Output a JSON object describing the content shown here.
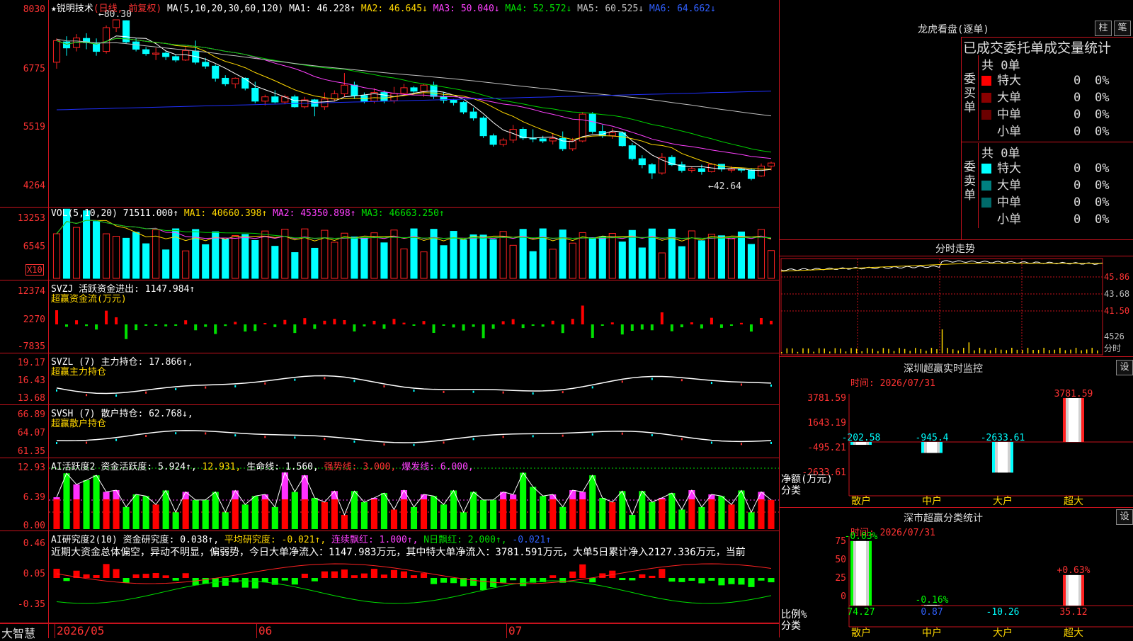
{
  "colors": {
    "up": "#ff2222",
    "down": "#00ffff",
    "grid": "#c8121d",
    "ma1": "#ffffff",
    "ma2": "#ffd700",
    "ma3": "#ff40ff",
    "ma4": "#00d000",
    "ma5": "#c0c0c0",
    "ma6": "#2030ff"
  },
  "kline": {
    "star": "★",
    "name": "锐明技术",
    "mode": "(日线, 前复权)",
    "ma_label": "MA(5,10,20,30,60,120)",
    "ma": [
      {
        "label": "MA1: 46.228↑",
        "color": "#ffffff"
      },
      {
        "label": "MA2: 46.645↓",
        "color": "#ffd700"
      },
      {
        "label": "MA3: 50.040↓",
        "color": "#ff40ff"
      },
      {
        "label": "MA4: 52.572↓",
        "color": "#00e000"
      },
      {
        "label": "MA5: 60.525↓",
        "color": "#c0c0c0"
      },
      {
        "label": "MA6: 64.662↓",
        "color": "#3060ff"
      }
    ],
    "y_labels": [
      "8030",
      "6775",
      "5519",
      "4264"
    ],
    "high_note": "←80.30",
    "low_note": "←42.64"
  },
  "vol": {
    "label": "VOL(5,10,20)",
    "value": "71511.000↑",
    "ma": [
      {
        "label": "MA1: 40660.398↑",
        "color": "#ffd700"
      },
      {
        "label": "MA2: 45350.898↑",
        "color": "#ff40ff"
      },
      {
        "label": "MA3: 46663.250↑",
        "color": "#00e000"
      }
    ],
    "y_labels": [
      "13253",
      "6545"
    ],
    "unit": "X10"
  },
  "svzj": {
    "label": "SVZJ  活跃资金进出: 1147.984↑",
    "sub": "超赢资金流(万元)",
    "y_labels": [
      "12374",
      "2270",
      "-7835"
    ]
  },
  "svzl": {
    "label": "SVZL (7) 主力持仓: 17.866↑,",
    "sub": "超赢主力持仓",
    "y_labels": [
      "19.17",
      "16.43",
      "13.68"
    ]
  },
  "svsh": {
    "label": "SVSH (7) 散户持仓: 62.768↓,",
    "sub": "超赢散户持仓",
    "y_labels": [
      "66.89",
      "64.07",
      "61.35"
    ]
  },
  "ai1": {
    "label": "AI活跃度2",
    "parts": [
      {
        "t": "资金活跃度: 5.924↑,",
        "c": "#ffffff"
      },
      {
        "t": "12.931,",
        "c": "#ffd700"
      },
      {
        "t": "生命线: 1.560,",
        "c": "#ffffff"
      },
      {
        "t": "强势线: 3.000,",
        "c": "#ff3333"
      },
      {
        "t": "爆发线: 6.000,",
        "c": "#ff40ff"
      }
    ],
    "y_labels": [
      "12.93",
      "6.39",
      "0.00"
    ]
  },
  "ai2": {
    "label": "AI研究度2(10)",
    "parts": [
      {
        "t": "资金研究度: 0.038↑,",
        "c": "#ffffff"
      },
      {
        "t": "平均研究度: -0.021↑,",
        "c": "#ffd700"
      },
      {
        "t": "连续飘红: 1.000↑,",
        "c": "#ff40ff"
      },
      {
        "t": "N日飘红: 2.000↑,",
        "c": "#00e000"
      },
      {
        "t": "-0.021↑",
        "c": "#3060ff"
      }
    ],
    "text": "近期大资金总体偏空，异动不明显，偏弱势，今日大单净流入：1147.983万元，其中特大单净流入：3781.591万元，大单5日累计净入2127.336万元，当前",
    "y_labels": [
      "0.46",
      "0.05",
      "-0.35"
    ]
  },
  "bottom": {
    "brand": "大智慧",
    "dates": [
      "2026/05",
      "06",
      "07"
    ]
  },
  "lhb": {
    "title": "龙虎看盘(逐单)",
    "btn1": "柱",
    "btn2": "笔",
    "header": "已成交委托单成交量统计",
    "buy": {
      "side": "委买单",
      "total": "共 0单",
      "rows": [
        {
          "name": "特大",
          "qty": "0",
          "pct": "0%",
          "color": "#ff0000"
        },
        {
          "name": "大单",
          "qty": "0",
          "pct": "0%",
          "color": "#8b0000"
        },
        {
          "name": "中单",
          "qty": "0",
          "pct": "0%",
          "color": "#6b0000"
        },
        {
          "name": "小单",
          "qty": "0",
          "pct": "0%",
          "color": ""
        }
      ]
    },
    "sell": {
      "side": "委卖单",
      "total": "共 0单",
      "rows": [
        {
          "name": "特大",
          "qty": "0",
          "pct": "0%",
          "color": "#00ffff"
        },
        {
          "name": "大单",
          "qty": "0",
          "pct": "0%",
          "color": "#008080"
        },
        {
          "name": "中单",
          "qty": "0",
          "pct": "0%",
          "color": "#006a6a"
        },
        {
          "name": "小单",
          "qty": "0",
          "pct": "0%",
          "color": ""
        }
      ]
    }
  },
  "intraday": {
    "title": "分时走势",
    "y_labels": [
      "45.86",
      "43.68",
      "41.50",
      "4526",
      "分时"
    ]
  },
  "sz_monitor": {
    "title": "深圳超赢实时监控",
    "btn": "设",
    "time": "时间: 2026/07/31",
    "y_labels": [
      "3781.59",
      "1643.19",
      "-495.21",
      "-2633.61"
    ],
    "axis_title": "净额(万元)",
    "axis_sub": "分类",
    "categories": [
      "散户",
      "中户",
      "大户",
      "超大"
    ],
    "values": [
      "-202.58",
      "-945.4",
      "-2633.61",
      "3781.59"
    ]
  },
  "sz_stat": {
    "title": "深市超赢分类统计",
    "btn": "设",
    "time": "时间: 2026/07/31",
    "y_labels": [
      "75",
      "50",
      "25",
      "0"
    ],
    "axis_title": "比例%",
    "axis_sub": "分类",
    "categories": [
      "散户",
      "中户",
      "大户",
      "超大"
    ],
    "top_labels": [
      "-0.03%",
      "-0.16%",
      "",
      "+0.63%"
    ],
    "values": [
      "74.27",
      "0.87",
      "-10.26",
      "35.12"
    ]
  },
  "chart_data": {
    "type": "candlestick",
    "x_labels": [
      "2026/05",
      "06",
      "07"
    ],
    "ylim": [
      42.64,
      80.3
    ],
    "candles": [
      [
        70.5,
        75.5,
        69,
        76
      ],
      [
        75.2,
        73.8,
        72,
        76.5
      ],
      [
        73.9,
        76.1,
        73,
        77
      ],
      [
        76,
        75,
        73.5,
        77.2
      ],
      [
        75,
        73,
        72,
        76
      ],
      [
        73,
        78.5,
        72.5,
        79
      ],
      [
        78.5,
        80.3,
        77.5,
        80.3
      ],
      [
        80.1,
        75.2,
        74.8,
        80.2
      ],
      [
        75.2,
        73.5,
        73,
        76
      ],
      [
        73.4,
        72.5,
        72,
        74
      ],
      [
        72.4,
        72.6,
        71,
        73.8
      ],
      [
        72.6,
        71.8,
        71,
        73
      ],
      [
        71.8,
        71,
        70.5,
        72.2
      ],
      [
        71,
        73.2,
        70.8,
        74
      ],
      [
        73.1,
        70.5,
        70,
        75.5
      ],
      [
        70.5,
        69.6,
        69,
        71.5
      ],
      [
        69.6,
        66.8,
        66,
        70
      ],
      [
        66.8,
        65.5,
        65,
        67.5
      ],
      [
        65.5,
        66.8,
        64.5,
        67
      ],
      [
        66.8,
        64.5,
        64,
        67
      ],
      [
        64.5,
        61.5,
        61,
        66
      ],
      [
        61.5,
        62.5,
        60.5,
        63
      ],
      [
        62.5,
        61.3,
        61,
        64
      ],
      [
        61.3,
        62.5,
        60.8,
        63
      ],
      [
        62.5,
        60.2,
        60,
        63
      ],
      [
        60.2,
        61.8,
        59.8,
        62.5
      ],
      [
        61.8,
        60.3,
        58,
        62
      ],
      [
        60.2,
        62,
        59.5,
        63.5
      ],
      [
        62,
        63.2,
        61.5,
        64
      ],
      [
        63.2,
        65.2,
        62.5,
        68
      ],
      [
        65.2,
        62.8,
        62,
        66
      ],
      [
        62.8,
        61.5,
        61,
        63.5
      ],
      [
        61.5,
        63.5,
        61,
        64.5
      ],
      [
        63.5,
        61.6,
        61,
        64
      ],
      [
        61.6,
        63.3,
        61,
        64.8
      ],
      [
        63.3,
        64.6,
        62.8,
        65.5
      ],
      [
        64.6,
        63.8,
        63.2,
        65
      ],
      [
        63.8,
        65.2,
        62.5,
        65.5
      ],
      [
        65.2,
        62.6,
        62,
        66
      ],
      [
        62.6,
        61.7,
        61,
        63.5
      ],
      [
        61.7,
        61.2,
        60.5,
        62
      ],
      [
        61.2,
        59,
        58.5,
        61.5
      ],
      [
        59,
        57.6,
        57,
        60
      ],
      [
        57.6,
        53.5,
        53,
        58
      ],
      [
        53.5,
        51.5,
        51,
        54
      ],
      [
        51.5,
        52.5,
        51,
        53
      ],
      [
        52.5,
        55,
        51.8,
        56
      ],
      [
        55,
        53,
        52.5,
        55.5
      ],
      [
        53,
        52.8,
        52,
        55
      ],
      [
        52.8,
        52.3,
        51.8,
        53.5
      ],
      [
        52.3,
        52.9,
        51.5,
        54
      ],
      [
        52.9,
        50.5,
        50,
        54.5
      ],
      [
        50.5,
        52.3,
        50,
        53
      ],
      [
        52.3,
        58.5,
        52,
        59
      ],
      [
        58.5,
        54.5,
        54,
        59
      ],
      [
        54.5,
        53.5,
        53,
        56
      ],
      [
        53.5,
        54.2,
        52.8,
        55.2
      ],
      [
        54.2,
        51.2,
        51,
        54.5
      ],
      [
        51.2,
        48.2,
        47.8,
        51.8
      ],
      [
        48.2,
        46.8,
        46,
        49
      ],
      [
        46.8,
        44.9,
        43.5,
        47.2
      ],
      [
        44.9,
        48.5,
        44.5,
        49.5
      ],
      [
        48.5,
        46.8,
        46.5,
        49
      ],
      [
        46.8,
        45.5,
        45,
        47.5
      ],
      [
        45.5,
        45.9,
        45,
        46.3
      ],
      [
        45.9,
        45.2,
        44.5,
        46.8
      ],
      [
        45.2,
        46.9,
        45,
        47.2
      ],
      [
        46.9,
        45.8,
        45.2,
        47
      ],
      [
        45.8,
        45.8,
        45,
        46.5
      ],
      [
        45.8,
        45.6,
        45,
        46
      ],
      [
        45.6,
        43.6,
        43.2,
        46
      ],
      [
        44.2,
        46.5,
        44,
        47.1
      ],
      [
        46.5,
        47.2,
        45.5,
        47.5
      ]
    ]
  }
}
